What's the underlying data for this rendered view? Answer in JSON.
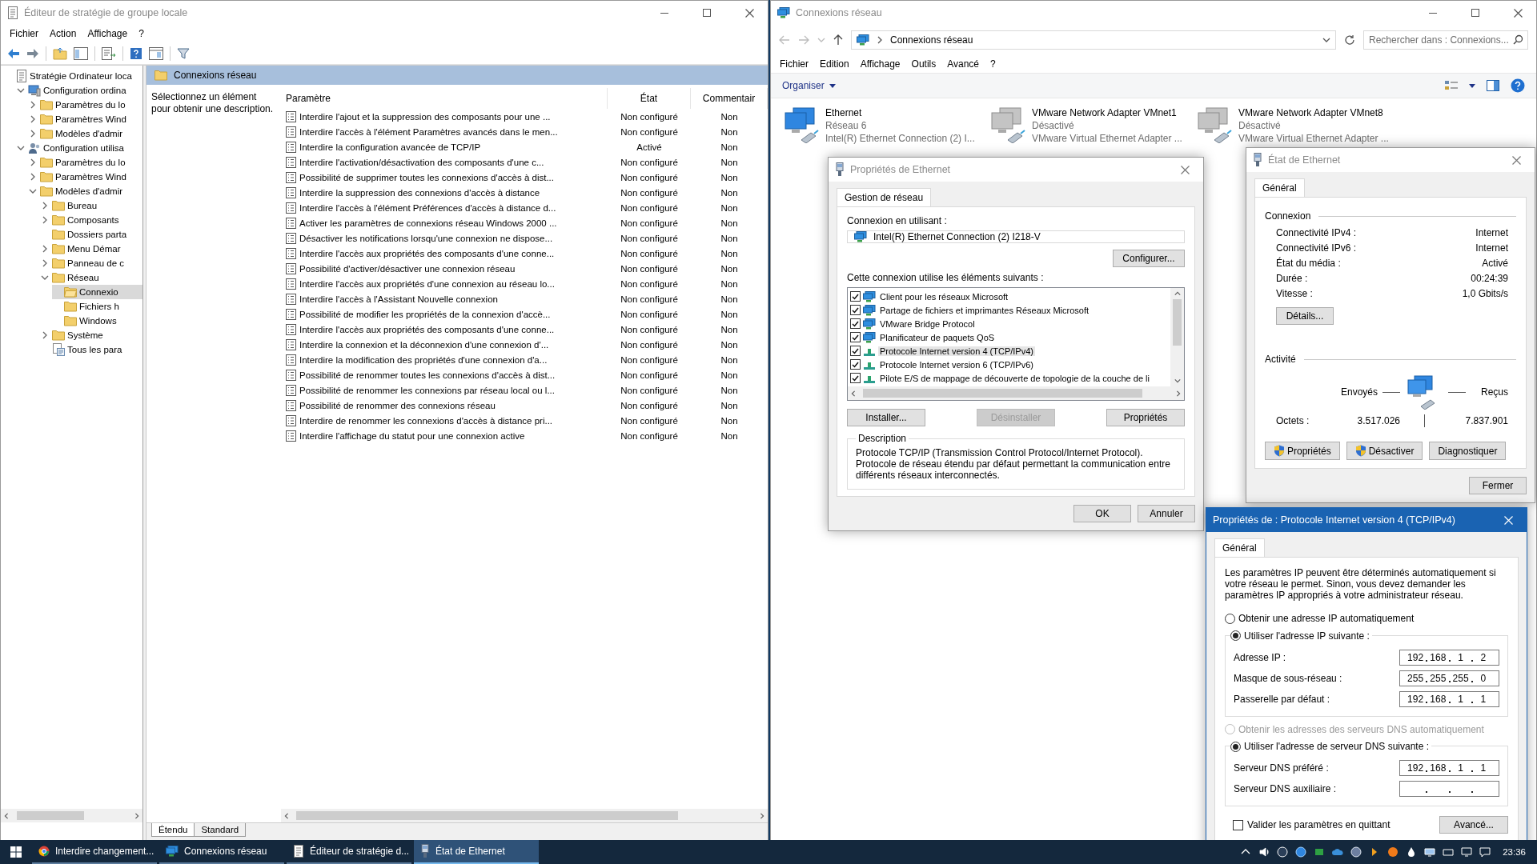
{
  "gpedit": {
    "title": "Éditeur de stratégie de groupe locale",
    "menu": [
      "Fichier",
      "Action",
      "Affichage",
      "?"
    ],
    "tree": [
      {
        "label": "Stratégie Ordinateur loca",
        "kind": "policy",
        "expandable": false,
        "selected": false,
        "children": [
          {
            "label": "Configuration ordina",
            "kind": "computer",
            "expandable": true,
            "expanded": true,
            "selected": false,
            "children": [
              {
                "label": "Paramètres du lo",
                "kind": "folder",
                "expandable": true,
                "expanded": false,
                "selected": false
              },
              {
                "label": "Paramètres Wind",
                "kind": "folder",
                "expandable": true,
                "expanded": false,
                "selected": false
              },
              {
                "label": "Modèles d'admir",
                "kind": "folder",
                "expandable": true,
                "expanded": false,
                "selected": false
              }
            ]
          },
          {
            "label": "Configuration utilisa",
            "kind": "user",
            "expandable": true,
            "expanded": true,
            "selected": false,
            "children": [
              {
                "label": "Paramètres du lo",
                "kind": "folder",
                "expandable": true,
                "expanded": false,
                "selected": false
              },
              {
                "label": "Paramètres Wind",
                "kind": "folder",
                "expandable": true,
                "expanded": false,
                "selected": false
              },
              {
                "label": "Modèles d'admir",
                "kind": "folder",
                "expandable": true,
                "expanded": true,
                "selected": false,
                "children": [
                  {
                    "label": "Bureau",
                    "kind": "folder",
                    "expandable": true,
                    "expanded": false,
                    "selected": false
                  },
                  {
                    "label": "Composants",
                    "kind": "folder",
                    "expandable": true,
                    "expanded": false,
                    "selected": false
                  },
                  {
                    "label": "Dossiers parta",
                    "kind": "folder",
                    "expandable": false,
                    "expanded": false,
                    "selected": false
                  },
                  {
                    "label": "Menu Démar",
                    "kind": "folder",
                    "expandable": true,
                    "expanded": false,
                    "selected": false
                  },
                  {
                    "label": "Panneau de c",
                    "kind": "folder",
                    "expandable": true,
                    "expanded": false,
                    "selected": false
                  },
                  {
                    "label": "Réseau",
                    "kind": "folder",
                    "expandable": true,
                    "expanded": true,
                    "selected": false,
                    "children": [
                      {
                        "label": "Connexio",
                        "kind": "folder",
                        "expandable": false,
                        "expanded": false,
                        "selected": true
                      },
                      {
                        "label": "Fichiers h",
                        "kind": "folder",
                        "expandable": false,
                        "expanded": false,
                        "selected": false
                      },
                      {
                        "label": "Windows",
                        "kind": "folder",
                        "expandable": false,
                        "expanded": false,
                        "selected": false
                      }
                    ]
                  },
                  {
                    "label": "Système",
                    "kind": "folder",
                    "expandable": true,
                    "expanded": false,
                    "selected": false
                  },
                  {
                    "label": "Tous les para",
                    "kind": "all",
                    "expandable": false,
                    "expanded": false,
                    "selected": false
                  }
                ]
              }
            ]
          }
        ]
      }
    ],
    "pane_header": "Connexions réseau",
    "description": "Sélectionnez un élément pour obtenir une description.",
    "columns": [
      "Paramètre",
      "État",
      "Commentair"
    ],
    "rows": [
      {
        "setting": "Interdire l'ajout et la suppression des composants pour une ...",
        "state": "Non configuré",
        "comment": "Non"
      },
      {
        "setting": "Interdire l'accès à l'élément Paramètres avancés dans le men...",
        "state": "Non configuré",
        "comment": "Non"
      },
      {
        "setting": "Interdire la configuration avancée de TCP/IP",
        "state": "Activé",
        "comment": "Non"
      },
      {
        "setting": "Interdire l'activation/désactivation des composants d'une c...",
        "state": "Non configuré",
        "comment": "Non"
      },
      {
        "setting": "Possibilité de supprimer toutes les connexions d'accès à dist...",
        "state": "Non configuré",
        "comment": "Non"
      },
      {
        "setting": "Interdire la suppression des connexions d'accès à distance",
        "state": "Non configuré",
        "comment": "Non"
      },
      {
        "setting": "Interdire l'accès à l'élément Préférences d'accès à distance d...",
        "state": "Non configuré",
        "comment": "Non"
      },
      {
        "setting": "Activer les paramètres de connexions réseau Windows 2000 ...",
        "state": "Non configuré",
        "comment": "Non"
      },
      {
        "setting": "Désactiver les notifications lorsqu'une connexion ne dispose...",
        "state": "Non configuré",
        "comment": "Non"
      },
      {
        "setting": "Interdire l'accès aux propriétés des composants d'une conne...",
        "state": "Non configuré",
        "comment": "Non"
      },
      {
        "setting": "Possibilité d'activer/désactiver une connexion réseau",
        "state": "Non configuré",
        "comment": "Non"
      },
      {
        "setting": "Interdire l'accès aux propriétés d'une connexion au réseau lo...",
        "state": "Non configuré",
        "comment": "Non"
      },
      {
        "setting": "Interdire l'accès à l'Assistant Nouvelle connexion",
        "state": "Non configuré",
        "comment": "Non"
      },
      {
        "setting": "Possibilité de modifier les propriétés de la connexion d'accè...",
        "state": "Non configuré",
        "comment": "Non"
      },
      {
        "setting": "Interdire l'accès aux propriétés des composants d'une conne...",
        "state": "Non configuré",
        "comment": "Non"
      },
      {
        "setting": "Interdire la connexion et la déconnexion d'une connexion d'...",
        "state": "Non configuré",
        "comment": "Non"
      },
      {
        "setting": "Interdire la modification des propriétés d'une connexion d'a...",
        "state": "Non configuré",
        "comment": "Non"
      },
      {
        "setting": "Possibilité de renommer toutes les connexions d'accès à dist...",
        "state": "Non configuré",
        "comment": "Non"
      },
      {
        "setting": "Possibilité de renommer les connexions par réseau local ou l...",
        "state": "Non configuré",
        "comment": "Non"
      },
      {
        "setting": "Possibilité de renommer des connexions réseau",
        "state": "Non configuré",
        "comment": "Non"
      },
      {
        "setting": "Interdire de renommer les connexions d'accès à distance pri...",
        "state": "Non configuré",
        "comment": "Non"
      },
      {
        "setting": "Interdire l'affichage du statut pour une connexion active",
        "state": "Non configuré",
        "comment": "Non"
      }
    ],
    "view_tabs": [
      {
        "label": "Étendu",
        "selected": true
      },
      {
        "label": "Standard",
        "selected": false
      }
    ]
  },
  "explorer": {
    "title": "Connexions réseau",
    "address": "Connexions réseau",
    "search": {
      "placeholder": "Rechercher dans : Connexions..."
    },
    "menu": [
      "Fichier",
      "Edition",
      "Affichage",
      "Outils",
      "Avancé",
      "?"
    ],
    "command": "Organiser",
    "adapters": [
      {
        "name": "Ethernet",
        "status": "Réseau 6",
        "device": "Intel(R) Ethernet Connection (2) I...",
        "disabled": false
      },
      {
        "name": "VMware Network Adapter VMnet1",
        "status": "Désactivé",
        "device": "VMware Virtual Ethernet Adapter ...",
        "disabled": true
      },
      {
        "name": "VMware Network Adapter VMnet8",
        "status": "Désactivé",
        "device": "VMware Virtual Ethernet Adapter ...",
        "disabled": true
      }
    ]
  },
  "ethernet_properties": {
    "title": "Propriétés de Ethernet",
    "tabs": [
      {
        "label": "Gestion de réseau",
        "selected": true
      }
    ],
    "connect_label": "Connexion en utilisant :",
    "adapter": "Intel(R) Ethernet Connection (2) I218-V",
    "configure_button": "Configurer...",
    "items_label": "Cette connexion utilise les éléments suivants :",
    "items": [
      {
        "label": "Client pour les réseaux Microsoft",
        "kind": "service",
        "checked": true,
        "selected": false
      },
      {
        "label": "Partage de fichiers et imprimantes Réseaux Microsoft",
        "kind": "service",
        "checked": true,
        "selected": false
      },
      {
        "label": "VMware Bridge Protocol",
        "kind": "service",
        "checked": true,
        "selected": false
      },
      {
        "label": "Planificateur de paquets QoS",
        "kind": "service",
        "checked": true,
        "selected": false
      },
      {
        "label": "Protocole Internet version 4 (TCP/IPv4)",
        "kind": "protocol",
        "checked": true,
        "selected": true
      },
      {
        "label": "Protocole Internet version 6 (TCP/IPv6)",
        "kind": "protocol",
        "checked": true,
        "selected": false
      },
      {
        "label": "Pilote E/S de mappage de découverte de topologie de la couche de li",
        "kind": "protocol",
        "checked": true,
        "selected": false
      }
    ],
    "buttons": [
      {
        "label": "Installer...",
        "disabled": false
      },
      {
        "label": "Désinstaller",
        "disabled": true
      },
      {
        "label": "Propriétés",
        "disabled": false
      }
    ],
    "description": {
      "title": "Description",
      "text": "Protocole TCP/IP (Transmission Control Protocol/Internet Protocol). Protocole de réseau étendu par défaut permettant la communication entre différents réseaux interconnectés."
    },
    "footer_buttons": [
      "OK",
      "Annuler"
    ]
  },
  "ethernet_status": {
    "title": "État de Ethernet",
    "tabs": [
      {
        "label": "Général",
        "selected": true
      }
    ],
    "connection_title": "Connexion",
    "rows": [
      {
        "label": "Connectivité IPv4 :",
        "value": "Internet"
      },
      {
        "label": "Connectivité IPv6 :",
        "value": "Internet"
      },
      {
        "label": "État du média :",
        "value": "Activé"
      },
      {
        "label": "Durée :",
        "value": "00:24:39"
      },
      {
        "label": "Vitesse :",
        "value": "1,0 Gbits/s"
      }
    ],
    "details_button": "Détails...",
    "activity_title": "Activité",
    "sent_label": "Envoyés",
    "received_label": "Reçus",
    "bytes_label": "Octets :",
    "sent": "3.517.026",
    "received": "7.837.901",
    "buttons": [
      {
        "label": "Propriétés",
        "shield": true
      },
      {
        "label": "Désactiver",
        "shield": true
      },
      {
        "label": "Diagnostiquer",
        "shield": false
      }
    ],
    "close_button": "Fermer"
  },
  "ipv4": {
    "title": "Propriétés de : Protocole Internet version 4 (TCP/IPv4)",
    "tabs": [
      {
        "label": "Général",
        "selected": true
      }
    ],
    "intro": "Les paramètres IP peuvent être déterminés automatiquement si votre réseau le permet. Sinon, vous devez demander les paramètres IP appropriés à votre administrateur réseau.",
    "ip_options": [
      {
        "label": "Obtenir une adresse IP automatiquement",
        "selected": false,
        "disabled": false
      },
      {
        "label": "Utiliser l'adresse IP suivante :",
        "selected": true,
        "disabled": false
      }
    ],
    "ip_fields": [
      {
        "label": "Adresse IP :",
        "octets": [
          "192",
          "168",
          "1",
          "2"
        ]
      },
      {
        "label": "Masque de sous-réseau :",
        "octets": [
          "255",
          "255",
          "255",
          "0"
        ]
      },
      {
        "label": "Passerelle par défaut :",
        "octets": [
          "192",
          "168",
          "1",
          "1"
        ]
      }
    ],
    "dns_options": [
      {
        "label": "Obtenir les adresses des serveurs DNS automatiquement",
        "selected": false,
        "disabled": true
      },
      {
        "label": "Utiliser l'adresse de serveur DNS suivante :",
        "selected": true,
        "disabled": false
      }
    ],
    "dns_fields": [
      {
        "label": "Serveur DNS préféré :",
        "octets": [
          "192",
          "168",
          "1",
          "1"
        ]
      },
      {
        "label": "Serveur DNS auxiliaire :"
      }
    ],
    "validate": {
      "label": "Valider les paramètres en quittant",
      "checked": false
    },
    "advanced_button": "Avancé..."
  },
  "taskbar": {
    "tasks": [
      {
        "label": "Interdire changement...",
        "kind": "browser",
        "selected": false
      },
      {
        "label": "Connexions réseau",
        "kind": "network",
        "selected": false
      },
      {
        "label": "Éditeur de stratégie d...",
        "kind": "policy",
        "selected": false
      },
      {
        "label": "État de Ethernet",
        "kind": "adapter",
        "selected": true
      }
    ],
    "time": "23:36"
  }
}
